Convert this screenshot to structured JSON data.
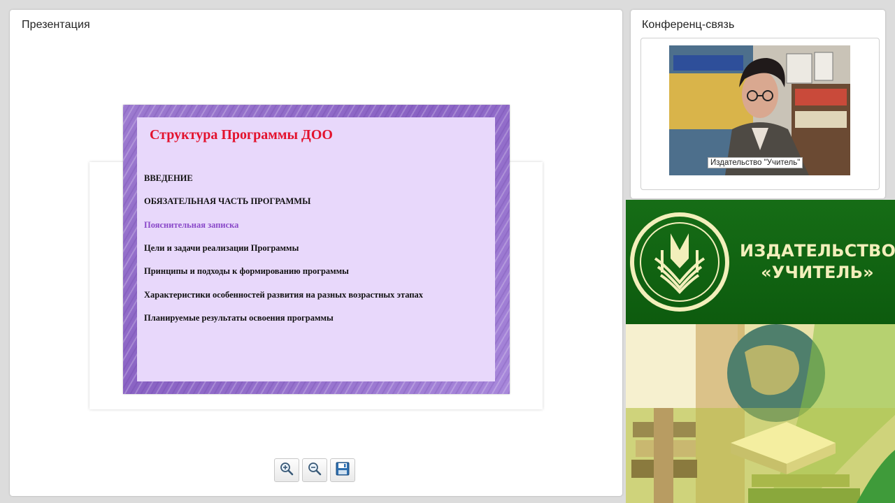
{
  "presentation": {
    "title": "Презентация",
    "slide": {
      "title": "Структура Программы ДОО",
      "items": [
        "ВВЕДЕНИЕ",
        "ОБЯЗАТЕЛЬНАЯ ЧАСТЬ ПРОГРАММЫ",
        "Пояснительная записка",
        "Цели и задачи реализации Программы",
        "Принципы и подходы к формированию программы",
        "Характеристики особенностей развития на разных возрастных этапах",
        "Планируемые результаты освоения программы"
      ]
    },
    "toolbar": {
      "zoom_in_icon": "zoom-in-icon",
      "zoom_out_icon": "zoom-out-icon",
      "save_icon": "save-icon"
    }
  },
  "conference": {
    "title": "Конференц-связь",
    "video_caption": "Издательство \"Учитель\""
  },
  "brand": {
    "name_line1": "ИЗДАТЕЛЬСТВО",
    "name_line2": "«УЧИТЕЛЬ»"
  },
  "colors": {
    "slide_title": "#e3122d",
    "slide_highlight": "#8a49c9",
    "brand_green": "#0f5f10",
    "brand_text": "#f3efbb"
  }
}
